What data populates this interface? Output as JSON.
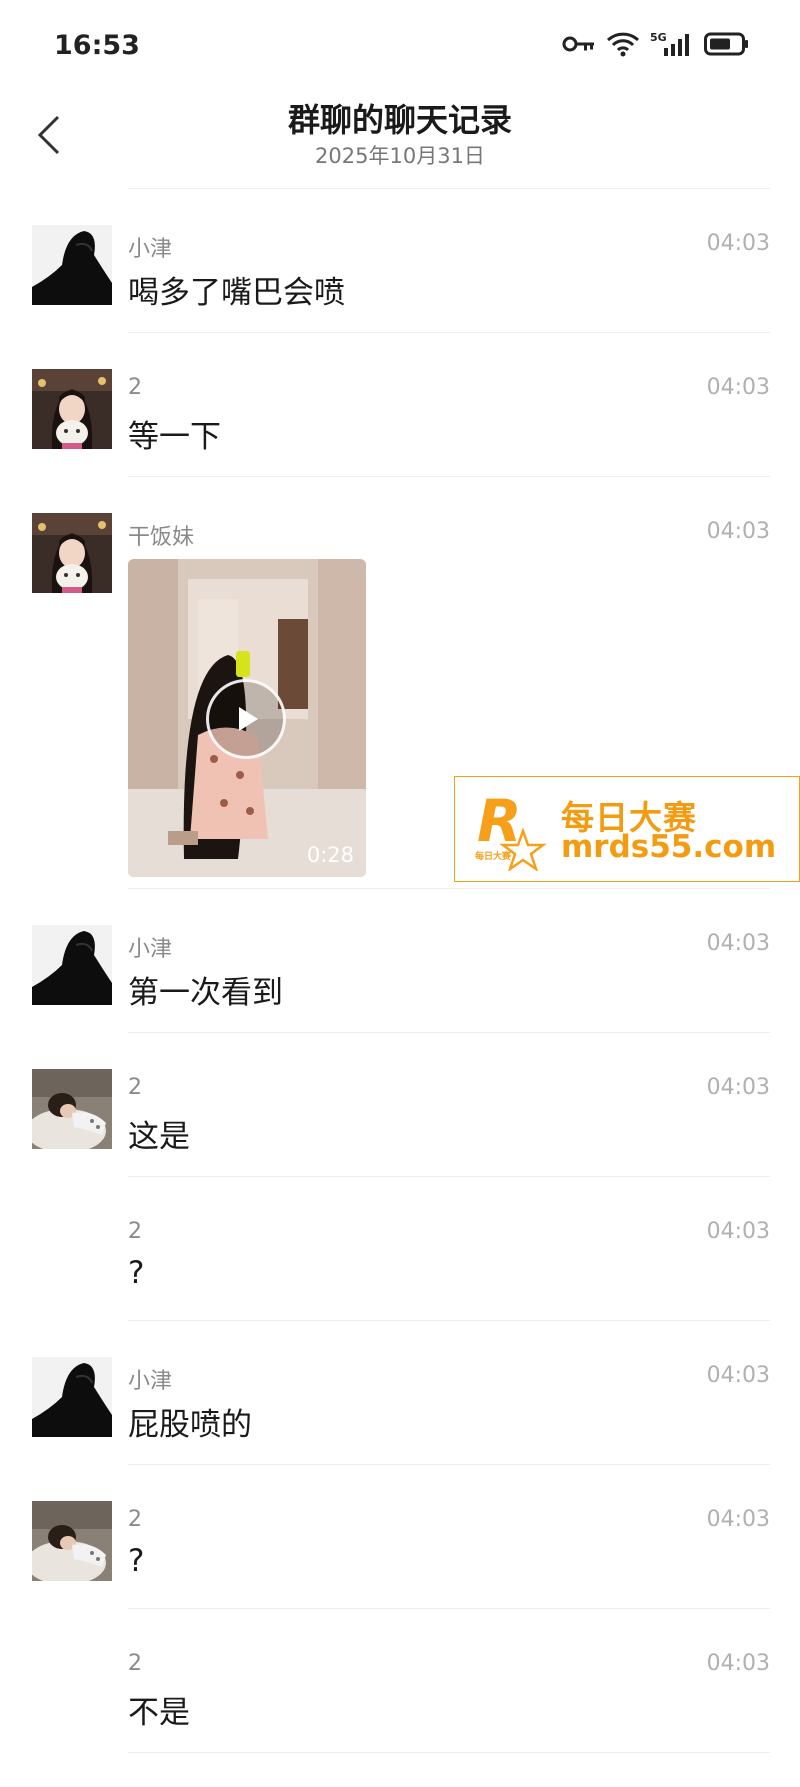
{
  "status_bar": {
    "time": "16:53",
    "network": "5G",
    "icons": [
      "key-icon",
      "wifi-icon",
      "signal-5g-icon",
      "battery-icon"
    ]
  },
  "header": {
    "title": "群聊的聊天记录",
    "date": "2025年10月31日",
    "back_icon": "chevron-left-icon"
  },
  "messages": [
    {
      "sender": "小津",
      "time": "04:03",
      "text": "喝多了嘴巴会喷",
      "avatar": "dark-silhouette",
      "show_avatar": true
    },
    {
      "sender": "2",
      "time": "04:03",
      "text": "等一下",
      "avatar": "girl-with-plush",
      "show_avatar": true
    },
    {
      "sender": "干饭妹",
      "time": "04:03",
      "type": "video",
      "duration": "0:28",
      "avatar": "girl-with-plush",
      "show_avatar": true
    },
    {
      "sender": "小津",
      "time": "04:03",
      "text": "第一次看到",
      "avatar": "dark-silhouette",
      "show_avatar": true
    },
    {
      "sender": "2",
      "time": "04:03",
      "text": "这是",
      "avatar": "person-on-sofa",
      "show_avatar": true
    },
    {
      "sender": "2",
      "time": "04:03",
      "text": "?",
      "show_avatar": false
    },
    {
      "sender": "小津",
      "time": "04:03",
      "text": "屁股喷的",
      "avatar": "dark-silhouette",
      "show_avatar": true
    },
    {
      "sender": "2",
      "time": "04:03",
      "text": "?",
      "avatar": "person-on-sofa",
      "show_avatar": true
    },
    {
      "sender": "2",
      "time": "04:03",
      "text": "不是",
      "show_avatar": false
    }
  ],
  "watermark": {
    "logo_letter": "R",
    "logo_small": "每日大赛",
    "name": "每日大赛",
    "url": "mrds55.com",
    "color": "#f39c12"
  }
}
